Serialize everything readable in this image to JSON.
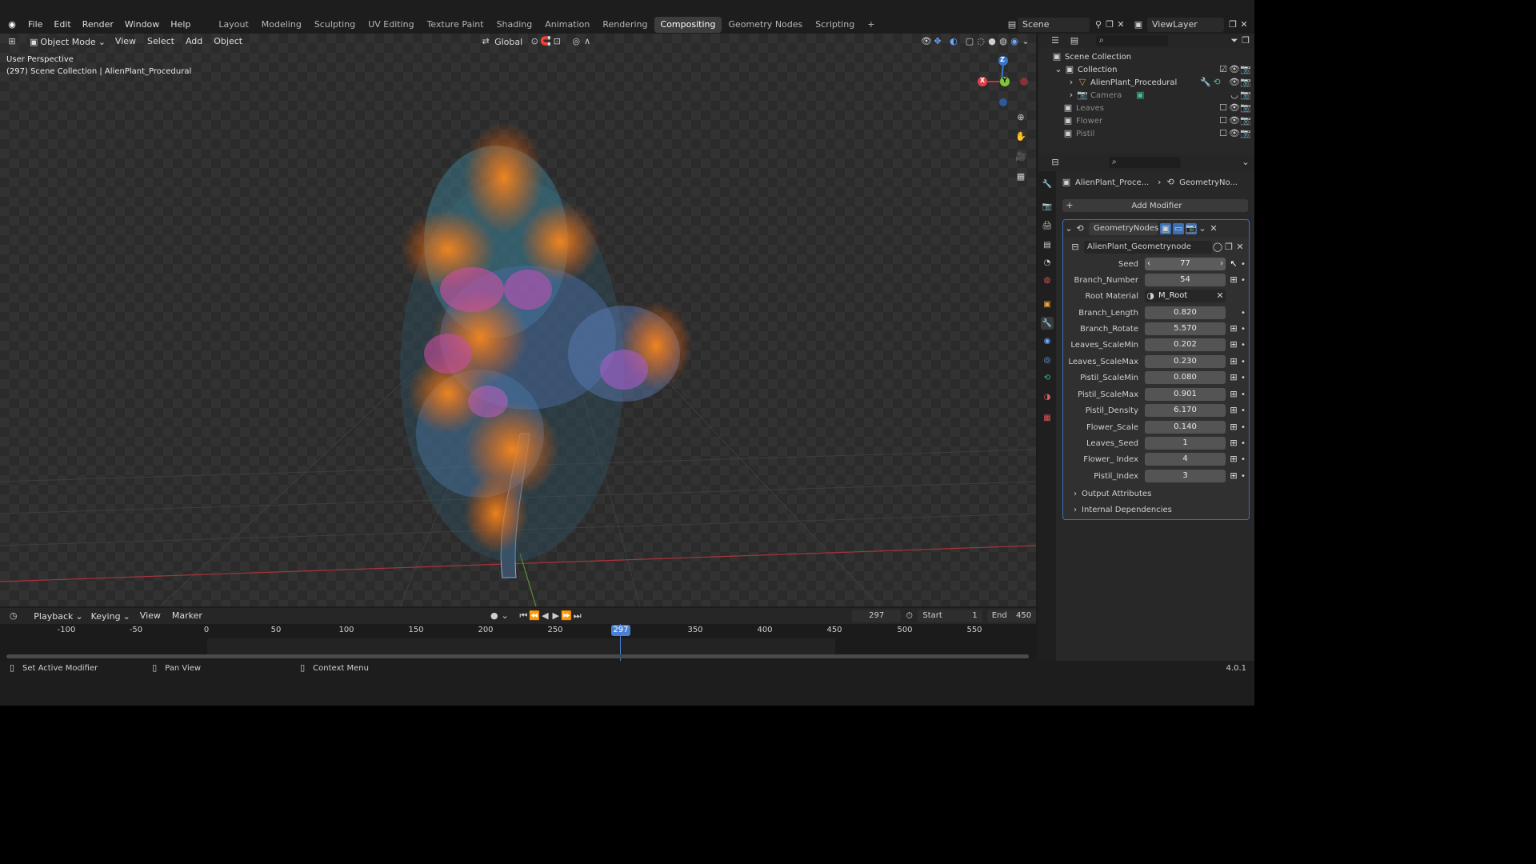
{
  "menu": {
    "items": [
      "File",
      "Edit",
      "Render",
      "Window",
      "Help"
    ]
  },
  "workspaces": {
    "tabs": [
      "Layout",
      "Modeling",
      "Sculpting",
      "UV Editing",
      "Texture Paint",
      "Shading",
      "Animation",
      "Rendering",
      "Compositing",
      "Geometry Nodes",
      "Scripting"
    ],
    "active": "Compositing",
    "add": "+"
  },
  "scene": {
    "name": "Scene",
    "view_layer": "ViewLayer"
  },
  "viewport": {
    "mode": "Object Mode",
    "menus": [
      "View",
      "Select",
      "Add",
      "Object"
    ],
    "orientation": "Global",
    "overlay_title": "User Perspective",
    "overlay_subtitle": "(297) Scene Collection | AlienPlant_Procedural",
    "gizmo": {
      "x": "X",
      "y": "Y",
      "z": "Z"
    }
  },
  "outliner": {
    "root": "Scene Collection",
    "items": [
      {
        "label": "Collection",
        "dim": false
      },
      {
        "label": "AlienPlant_Procedural",
        "dim": false
      },
      {
        "label": "Camera",
        "dim": true
      },
      {
        "label": "Leaves",
        "dim": true
      },
      {
        "label": "Flower",
        "dim": true
      },
      {
        "label": "Pistil",
        "dim": true
      }
    ]
  },
  "properties": {
    "breadcrumb_object": "AlienPlant_Proce...",
    "breadcrumb_modifier": "GeometryNo...",
    "add_modifier": "Add Modifier",
    "modifier_name": "GeometryNodes",
    "node_group": "AlienPlant_Geometrynode",
    "params": [
      {
        "label": "Seed",
        "value": "77"
      },
      {
        "label": "Branch_Number",
        "value": "54"
      },
      {
        "label": "Root Material",
        "value": "M_Root"
      },
      {
        "label": "Branch_Length",
        "value": "0.820"
      },
      {
        "label": "Branch_Rotate",
        "value": "5.570"
      },
      {
        "label": "Leaves_ScaleMin",
        "value": "0.202"
      },
      {
        "label": "Leaves_ScaleMax",
        "value": "0.230"
      },
      {
        "label": "Pistil_ScaleMin",
        "value": "0.080"
      },
      {
        "label": "Pistil_ScaleMax",
        "value": "0.901"
      },
      {
        "label": "Pistil_Density",
        "value": "6.170"
      },
      {
        "label": "Flower_Scale",
        "value": "0.140"
      },
      {
        "label": "Leaves_Seed",
        "value": "1"
      },
      {
        "label": "Flower_ Index",
        "value": "4"
      },
      {
        "label": "Pistil_Index",
        "value": "3"
      }
    ],
    "sections": [
      "Output Attributes",
      "Internal Dependencies"
    ]
  },
  "timeline": {
    "menus": [
      "Playback",
      "Keying",
      "View",
      "Marker"
    ],
    "current_frame": "297",
    "start_label": "Start",
    "start": "1",
    "end_label": "End",
    "end": "450",
    "ticks": [
      "-100",
      "-50",
      "0",
      "50",
      "100",
      "150",
      "200",
      "250",
      "300",
      "350",
      "400",
      "450",
      "500",
      "550"
    ],
    "playhead": "297"
  },
  "status": {
    "items": [
      "Set Active Modifier",
      "Pan View",
      "Context Menu"
    ],
    "version": "4.0.1"
  }
}
